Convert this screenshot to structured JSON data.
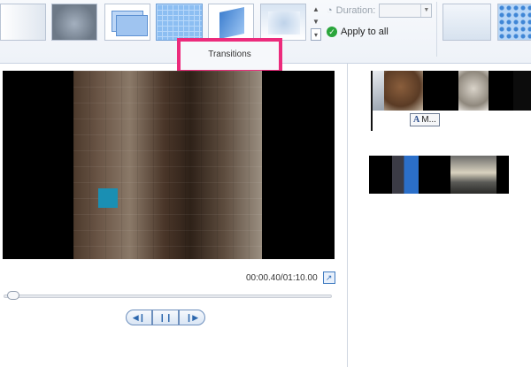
{
  "ribbon": {
    "duration_label": "Duration:",
    "duration_value": "",
    "apply_to_all_label": "Apply to all",
    "group_label": "Transitions",
    "icons": {
      "duration": "clock-icon",
      "apply": "check-icon",
      "scroll_up": "chevron-up-icon",
      "scroll_down": "chevron-down-icon",
      "more": "more-icon"
    }
  },
  "preview": {
    "time_readout": "00:00.40/01:10.00",
    "icons": {
      "popout": "popout-icon",
      "previous_frame": "previous-frame-icon",
      "play_pause": "pause-icon",
      "next_frame": "next-frame-icon"
    }
  },
  "seek": {
    "position_fraction": 0.0057
  },
  "storyboard": {
    "caption_chip_label": "M...",
    "caption_icon": "A"
  },
  "colors": {
    "highlight": "#ec2b7c",
    "accent": "#2e6db8",
    "apply_icon": "#2aa53b"
  }
}
